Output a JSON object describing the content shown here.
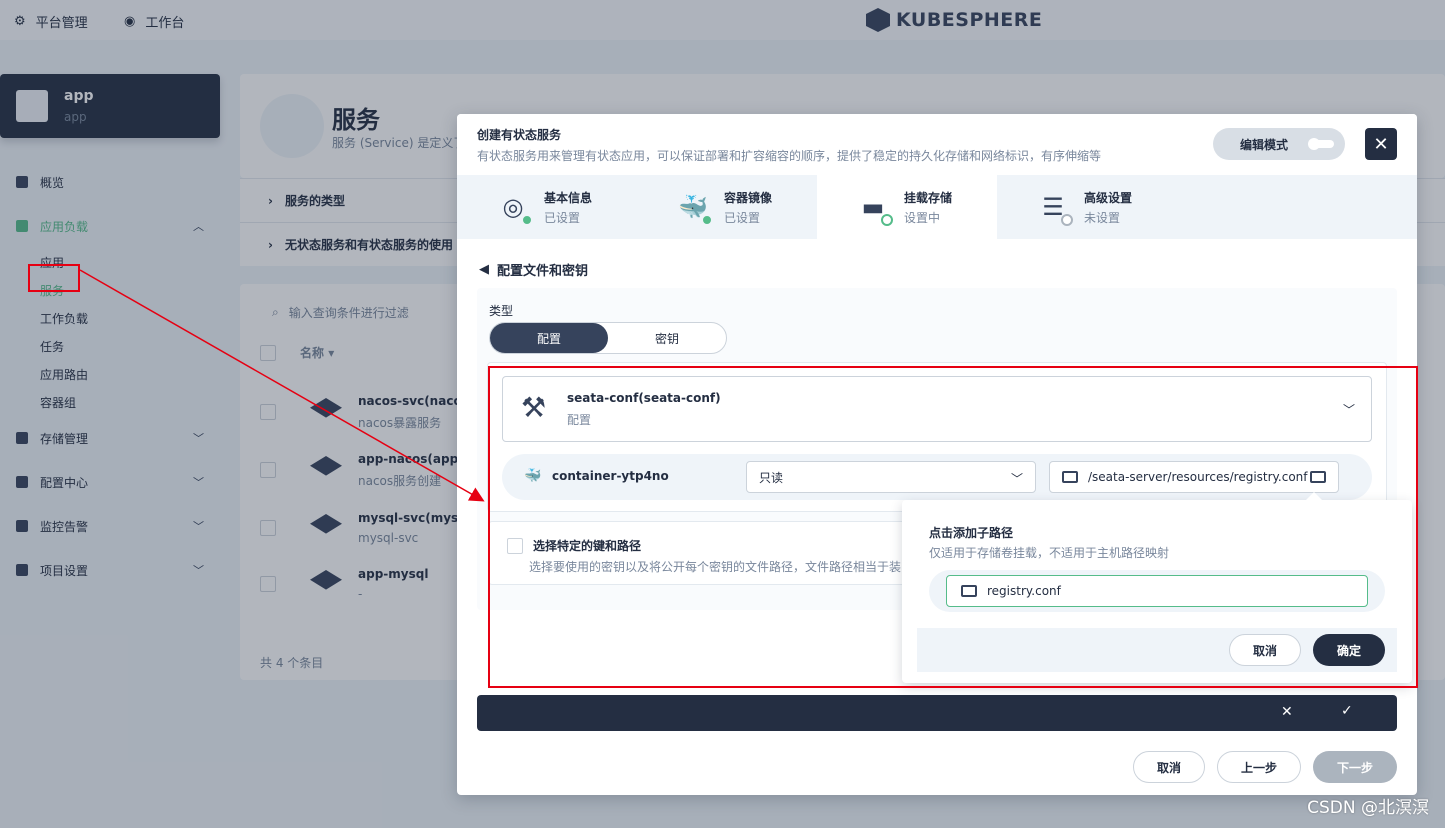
{
  "topbar": {
    "platform_label": "平台管理",
    "workbench_label": "工作台",
    "logo_text": "KUBESPHERE"
  },
  "sidebar": {
    "app_name": "app",
    "app_sub": "app",
    "items": [
      {
        "label": "概览"
      },
      {
        "label": "应用负载"
      },
      {
        "label": "存储管理"
      },
      {
        "label": "配置中心"
      },
      {
        "label": "监控告警"
      },
      {
        "label": "项目设置"
      }
    ],
    "sub_items": [
      {
        "label": "应用"
      },
      {
        "label": "服务"
      },
      {
        "label": "工作负载"
      },
      {
        "label": "任务"
      },
      {
        "label": "应用路由"
      },
      {
        "label": "容器组"
      }
    ]
  },
  "page": {
    "title": "服务",
    "desc": "服务 (Service) 是定义了",
    "acc1": "服务的类型",
    "acc2": "无状态服务和有状态服务的使用",
    "filter_placeholder": "输入查询条件进行过滤",
    "col_name": "名称",
    "rows": [
      {
        "name": "nacos-svc(nacos-s",
        "sub": "nacos暴露服务"
      },
      {
        "name": "app-nacos(app-na",
        "sub": "nacos服务创建"
      },
      {
        "name": "mysql-svc(mysql-s",
        "sub": "mysql-svc"
      },
      {
        "name": "app-mysql",
        "sub": "-"
      }
    ],
    "total": "共 4 个条目"
  },
  "modal": {
    "title": "创建有状态服务",
    "desc": "有状态服务用来管理有状态应用，可以保证部署和扩容缩容的顺序，提供了稳定的持久化存储和网络标识，有序伸缩等",
    "edit_mode": "编辑模式",
    "steps": [
      {
        "title": "基本信息",
        "status": "已设置"
      },
      {
        "title": "容器镜像",
        "status": "已设置"
      },
      {
        "title": "挂载存储",
        "status": "设置中"
      },
      {
        "title": "高级设置",
        "status": "未设置"
      }
    ],
    "back_label": "配置文件和密钥",
    "type_label": "类型",
    "seg_config": "配置",
    "seg_secret": "密钥",
    "config_name": "seata-conf(seata-conf)",
    "config_type": "配置",
    "container": "container-ytp4no",
    "access_mode": "只读",
    "mount_path": "/seata-server/resources/registry.conf",
    "keys_title": "选择特定的键和路径",
    "keys_desc": "选择要使用的密钥以及将公开每个密钥的文件路径，文件路径相当于装",
    "footer_cancel": "取消",
    "footer_prev": "上一步",
    "footer_next": "下一步"
  },
  "popover": {
    "title": "点击添加子路径",
    "desc": "仅适用于存储卷挂载，不适用于主机路径映射",
    "value": "registry.conf",
    "cancel": "取消",
    "confirm": "确定"
  },
  "watermark": "CSDN @北溟溟",
  "colors": {
    "accent": "#55bc8a",
    "dark": "#242e42",
    "annotation": "#e60012"
  }
}
